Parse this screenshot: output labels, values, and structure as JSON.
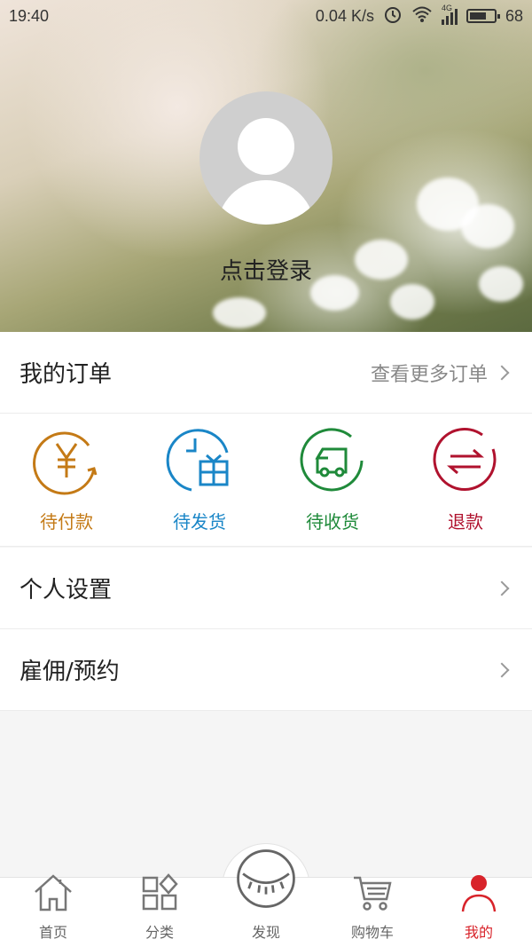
{
  "status_bar": {
    "time": "19:40",
    "net_speed": "0.04 K/s",
    "network": "4G",
    "battery": "68",
    "battery_level": 0.68
  },
  "profile": {
    "login_text": "点击登录"
  },
  "orders": {
    "title": "我的订单",
    "more_label": "查看更多订单",
    "items": [
      {
        "label": "待付款",
        "icon": "pending-payment-icon",
        "color": "#c47a16"
      },
      {
        "label": "待发货",
        "icon": "pending-shipment-icon",
        "color": "#1a86c7"
      },
      {
        "label": "待收货",
        "icon": "pending-receipt-icon",
        "color": "#1f8a3a"
      },
      {
        "label": "退款",
        "icon": "refund-icon",
        "color": "#b0122e"
      }
    ]
  },
  "menu": [
    {
      "label": "个人设置"
    },
    {
      "label": "雇佣/预约"
    }
  ],
  "tabbar": {
    "active_color": "#d8232a",
    "items": [
      {
        "label": "首页",
        "icon": "home-icon"
      },
      {
        "label": "分类",
        "icon": "category-icon"
      },
      {
        "label": "发现",
        "icon": "discover-icon"
      },
      {
        "label": "购物车",
        "icon": "cart-icon"
      },
      {
        "label": "我的",
        "icon": "profile-icon",
        "active": true
      }
    ]
  }
}
